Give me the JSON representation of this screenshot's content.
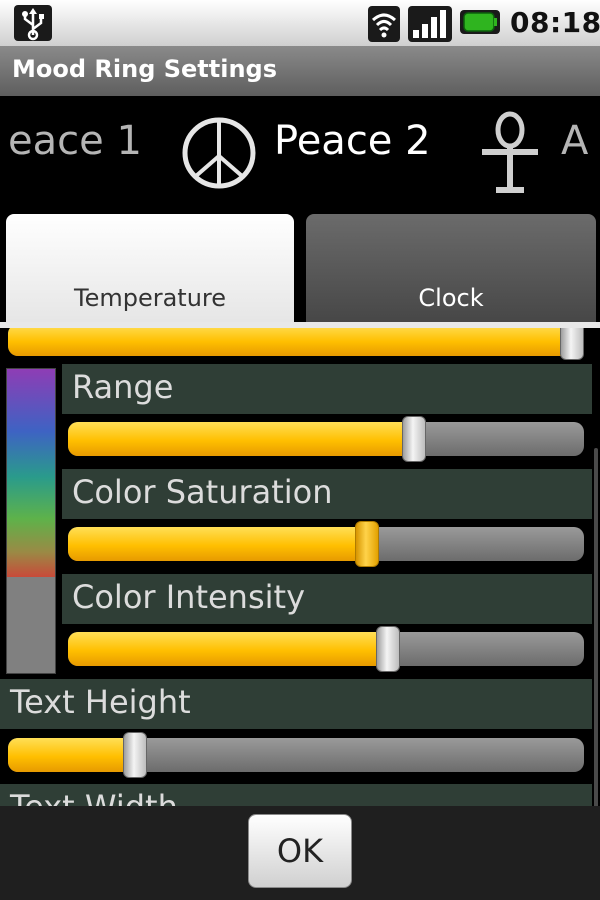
{
  "status_bar": {
    "time": "08:18"
  },
  "title_bar": {
    "title": "Mood Ring Settings"
  },
  "gallery": {
    "items": [
      {
        "label": "eace 1",
        "icon": "peace-icon-partial"
      },
      {
        "label": "Peace 2",
        "icon": "peace-icon"
      },
      {
        "label": "A",
        "icon": "ankh-icon"
      }
    ]
  },
  "tabs": [
    {
      "label": "Temperature",
      "selected": true
    },
    {
      "label": "Clock",
      "selected": false
    }
  ],
  "settings": {
    "range": {
      "label": "Range",
      "value": 0.67
    },
    "color_saturation": {
      "label": "Color Saturation",
      "value": 0.58
    },
    "color_intensity": {
      "label": "Color Intensity",
      "value": 0.62
    },
    "text_height": {
      "label": "Text Height",
      "value": 0.22
    },
    "text_width": {
      "label": "Text Width"
    },
    "top_slider": {
      "value": 0.98
    }
  },
  "colors": {
    "accent": "#ffbf00",
    "label_bg": "#2f3e36"
  },
  "ok_button": {
    "label": "OK"
  }
}
